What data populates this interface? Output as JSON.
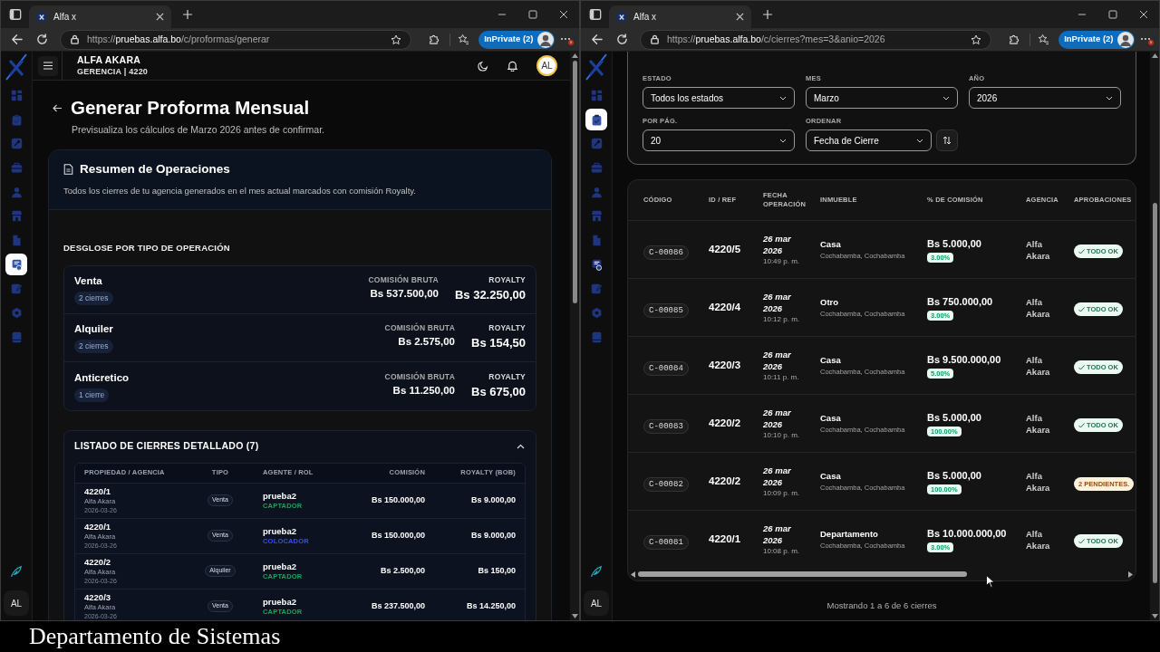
{
  "windows": [
    {
      "tab": {
        "title": "Alfa x"
      },
      "url": {
        "scheme": "https://",
        "host": "pruebas.alfa.bo",
        "path": "/c/proformas/generar"
      },
      "profile": "InPrivate (2)",
      "nav": [
        {
          "selected": false
        },
        {
          "selected": false
        },
        {
          "selected": false
        },
        {
          "selected": false
        },
        {
          "selected": false
        },
        {
          "selected": false
        },
        {
          "selected": false
        },
        {
          "selected": true
        },
        {
          "selected": false
        },
        {
          "selected": false
        },
        {
          "selected": false
        }
      ],
      "user_initials": "AL",
      "page": {
        "kind": "proforma",
        "header": {
          "name": "ALFA AKARA",
          "role": "GERENCIA | 4220",
          "avatar": "AL"
        },
        "title": "Generar Proforma Mensual",
        "subtitle": "Previsualiza los cálculos de Marzo 2026 antes de confirmar.",
        "summary": {
          "title": "Resumen de Operaciones",
          "description": "Todos los cierres de tu agencia generados en el mes actual marcados con comisión Royalty."
        },
        "breakdown": {
          "heading": "DESGLOSE POR TIPO DE OPERACIÓN",
          "items": [
            {
              "type": "Venta",
              "count": "2 cierres",
              "gross_label": "COMISIÓN BRUTA",
              "gross": "Bs 537.500,00",
              "royalty_label": "ROYALTY",
              "royalty": "Bs 32.250,00"
            },
            {
              "type": "Alquiler",
              "count": "2 cierres",
              "gross_label": "COMISIÓN BRUTA",
              "gross": "Bs 2.575,00",
              "royalty_label": "ROYALTY",
              "royalty": "Bs 154,50"
            },
            {
              "type": "Anticretico",
              "count": "1 cierre",
              "gross_label": "COMISIÓN BRUTA",
              "gross": "Bs 11.250,00",
              "royalty_label": "ROYALTY",
              "royalty": "Bs 675,00"
            }
          ]
        },
        "detail": {
          "title": "LISTADO DE CIERRES DETALLADO (7)",
          "expanded": true,
          "columns": [
            "PROPIEDAD / AGENCIA",
            "TIPO",
            "AGENTE / ROL",
            "COMISIÓN",
            "ROYALTY (BOB)"
          ],
          "rows": [
            {
              "property": "4220/1",
              "agency": "Alfa Akara",
              "date": "2026-03-26",
              "type": "Venta",
              "agent": "prueba2",
              "role": {
                "text": "CAPTADOR",
                "color": "#22a05a"
              },
              "commission": "Bs 150.000,00",
              "royalty": "Bs 9.000,00"
            },
            {
              "property": "4220/1",
              "agency": "Alfa Akara",
              "date": "2026-03-26",
              "type": "Venta",
              "agent": "prueba2",
              "role": {
                "text": "COLOCADOR",
                "color": "#3b4fe0"
              },
              "commission": "Bs 150.000,00",
              "royalty": "Bs 9.000,00"
            },
            {
              "property": "4220/2",
              "agency": "Alfa Akara",
              "date": "2026-03-26",
              "type": "Alquiler",
              "agent": "prueba2",
              "role": {
                "text": "CAPTADOR",
                "color": "#22a05a"
              },
              "commission": "Bs 2.500,00",
              "royalty": "Bs 150,00"
            },
            {
              "property": "4220/3",
              "agency": "Alfa Akara",
              "date": "2026-03-26",
              "type": "Venta",
              "agent": "prueba2",
              "role": {
                "text": "CAPTADOR",
                "color": "#22a05a"
              },
              "commission": "Bs 237.500,00",
              "royalty": "Bs 14.250,00"
            }
          ]
        }
      }
    },
    {
      "tab": {
        "title": "Alfa x"
      },
      "url": {
        "scheme": "https://",
        "host": "pruebas.alfa.bo",
        "path": "/c/cierres?mes=3&anio=2026"
      },
      "profile": "InPrivate (2)",
      "nav": [
        {
          "selected": false
        },
        {
          "selected": true
        },
        {
          "selected": false
        },
        {
          "selected": false
        },
        {
          "selected": false
        },
        {
          "selected": false
        },
        {
          "selected": false
        },
        {
          "selected": false
        },
        {
          "selected": false
        },
        {
          "selected": false
        },
        {
          "selected": false
        }
      ],
      "user_initials": "AL",
      "page": {
        "kind": "cierres",
        "filters": [
          {
            "label": "ESTADO",
            "value": "Todos los estados"
          },
          {
            "label": "MES",
            "value": "Marzo"
          },
          {
            "label": "AÑO",
            "value": "2026"
          },
          {
            "label": "POR PÁG.",
            "value": "20"
          },
          {
            "label": "ORDENAR",
            "value": "Fecha de Cierre"
          }
        ],
        "table": {
          "columns": [
            "CÓDIGO",
            "ID / REF",
            "FECHA OPERACIÓN",
            "INMUEBLE",
            "% DE COMISIÓN",
            "AGENCIA",
            "APROBACIONES"
          ],
          "rows": [
            {
              "code": "C-00086",
              "ref": "4220/5",
              "date": "26 mar 2026",
              "time": "10:49 p. m.",
              "property": "Casa",
              "location": "Cochabamba, Cochabamba",
              "amount": "Bs 5.000,00",
              "percent": "3.00%",
              "agency": "Alfa Akara",
              "approval": {
                "kind": "ok",
                "text": "TODO OK"
              }
            },
            {
              "code": "C-00085",
              "ref": "4220/4",
              "date": "26 mar 2026",
              "time": "10:12 p. m.",
              "property": "Otro",
              "location": "Cochabamba, Cochabamba",
              "amount": "Bs 750.000,00",
              "percent": "3.00%",
              "agency": "Alfa Akara",
              "approval": {
                "kind": "ok",
                "text": "TODO OK"
              }
            },
            {
              "code": "C-00084",
              "ref": "4220/3",
              "date": "26 mar 2026",
              "time": "10:11 p. m.",
              "property": "Casa",
              "location": "Cochabamba, Cochabamba",
              "amount": "Bs 9.500.000,00",
              "percent": "5.00%",
              "agency": "Alfa Akara",
              "approval": {
                "kind": "ok",
                "text": "TODO OK"
              }
            },
            {
              "code": "C-00083",
              "ref": "4220/2",
              "date": "26 mar 2026",
              "time": "10:10 p. m.",
              "property": "Casa",
              "location": "Cochabamba, Cochabamba",
              "amount": "Bs 5.000,00",
              "percent": "100.00%",
              "agency": "Alfa Akara",
              "approval": {
                "kind": "ok",
                "text": "TODO OK"
              }
            },
            {
              "code": "C-00082",
              "ref": "4220/2",
              "date": "26 mar 2026",
              "time": "10:09 p. m.",
              "property": "Casa",
              "location": "Cochabamba, Cochabamba",
              "amount": "Bs 5.000,00",
              "percent": "100.00%",
              "agency": "Alfa Akara",
              "approval": {
                "kind": "pending",
                "text": "2 PENDIENTES."
              }
            },
            {
              "code": "C-00081",
              "ref": "4220/1",
              "date": "26 mar 2026",
              "time": "10:08 p. m.",
              "property": "Departamento",
              "location": "Cochabamba, Cochabamba",
              "amount": "Bs 10.000.000,00",
              "percent": "3.00%",
              "agency": "Alfa Akara",
              "approval": {
                "kind": "ok",
                "text": "TODO OK"
              }
            }
          ]
        },
        "footer": "Mostrando 1 a 6 de 6 cierres"
      }
    }
  ],
  "caption": "Departamento de Sistemas"
}
